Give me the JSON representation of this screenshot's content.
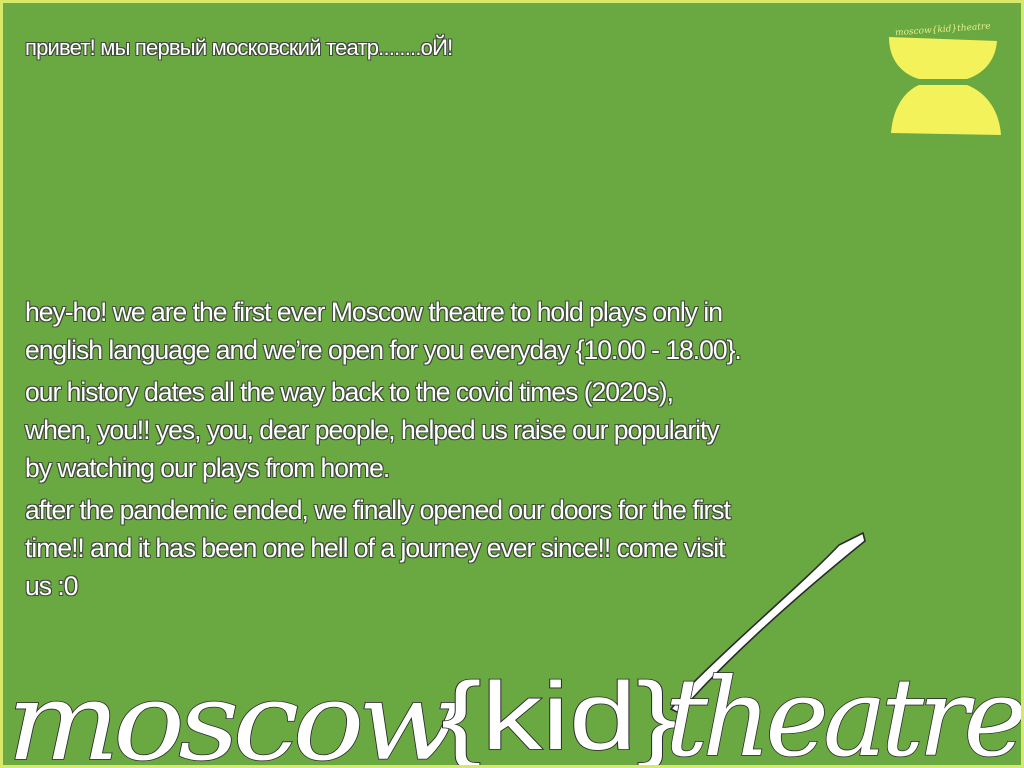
{
  "greeting": "привет! мы первый московский театр........оЙ!",
  "paragraphs": [
    "hey-ho! we are the first ever Moscow theatre to hold plays only in english language and we’re open for you everyday {10.00 - 18.00}.",
    "our history dates all the way back to the covid times (2020s), when, you!! yes, you, dear people, helped us raise our popularity by watching our plays from home.",
    "after the pandemic ended, we finally opened our doors for the first time!! and it has been one hell of a journey ever since!! come visit us :0"
  ],
  "logo": {
    "mark_text": "moscow{kid}theatre",
    "wordmark_left": "moscow",
    "wordmark_middle": "{kid}",
    "wordmark_right": "theatre"
  },
  "colors": {
    "background": "#6aa842",
    "border": "#d8e86a",
    "accent_yellow": "#f4f25a",
    "text": "#ffffff"
  },
  "icons": [
    "hourglass-logo-icon"
  ]
}
